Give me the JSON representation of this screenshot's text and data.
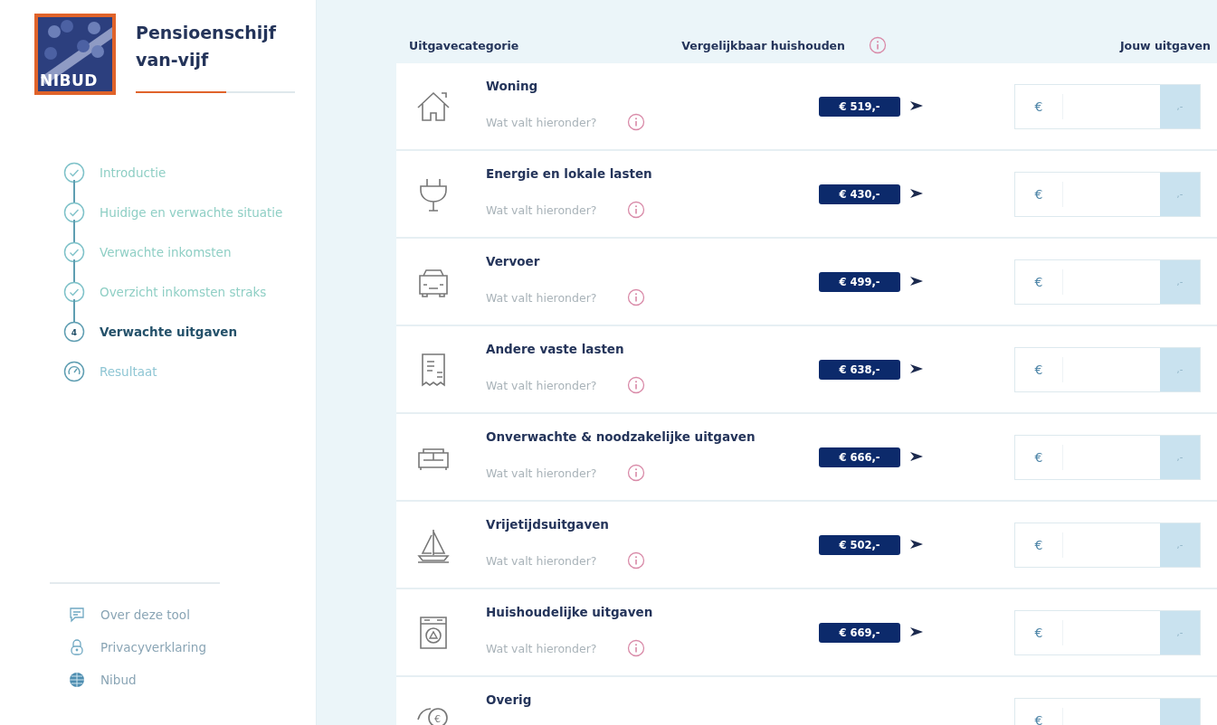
{
  "sidebar": {
    "logo": {
      "text": "NIBUD"
    },
    "title": "Pensioenschijf van-vijf",
    "progress": {
      "level": 0.57
    },
    "steps": [
      {
        "label": "Introductie",
        "kind": "check",
        "completed": true,
        "selected": false
      },
      {
        "label": "Huidige en verwachte situatie",
        "kind": "check",
        "completed": true,
        "selected": false
      },
      {
        "label": "Verwachte inkomsten",
        "kind": "check",
        "completed": true,
        "selected": false
      },
      {
        "label": "Overzicht inkomsten straks",
        "kind": "check",
        "completed": true,
        "selected": false
      },
      {
        "label": "Verwachte uitgaven",
        "kind": "number",
        "completed": false,
        "selected": true,
        "number": "4"
      },
      {
        "label": "Resultaat",
        "kind": "gauge",
        "completed": false,
        "selected": false
      }
    ],
    "footer_links": [
      {
        "label": "Over deze tool",
        "kind": "chat"
      },
      {
        "label": "Privacyverklaring",
        "kind": "lock"
      },
      {
        "label": "Nibud",
        "kind": "globe"
      }
    ]
  },
  "table": {
    "columns": [
      "Uitgavecategorie",
      "Vergelijkbaar huishouden",
      "Jouw uitgaven"
    ],
    "rows": [
      {
        "kind": "house",
        "title": "Woning",
        "help": "Wat valt hieronder?",
        "amount": "€ 519,-",
        "currency": "€",
        "suffix": ",-"
      },
      {
        "kind": "plug",
        "title": "Energie en lokale lasten",
        "help": "Wat valt hieronder?",
        "amount": "€ 430,-",
        "currency": "€",
        "suffix": ",-"
      },
      {
        "kind": "car",
        "title": "Vervoer",
        "help": "Wat valt hieronder?",
        "amount": "€ 499,-",
        "currency": "€",
        "suffix": ",-"
      },
      {
        "kind": "receipt",
        "title": "Andere vaste lasten",
        "help": "Wat valt hieronder?",
        "amount": "€ 638,-",
        "currency": "€",
        "suffix": ",-"
      },
      {
        "kind": "sofa",
        "title": "Onverwachte & noodzakelijke uitgaven",
        "help": "Wat valt hieronder?",
        "amount": "€ 666,-",
        "currency": "€",
        "suffix": ",-"
      },
      {
        "kind": "boat",
        "title": "Vrijetijdsuitgaven",
        "help": "Wat valt hieronder?",
        "amount": "€ 502,-",
        "currency": "€",
        "suffix": ",-"
      },
      {
        "kind": "washer",
        "title": "Huishoudelijke uitgaven",
        "help": "Wat valt hieronder?",
        "amount": "€ 669,-",
        "currency": "€",
        "suffix": ",-"
      },
      {
        "kind": "coins",
        "title": "Overig",
        "currency": "€"
      }
    ]
  }
}
